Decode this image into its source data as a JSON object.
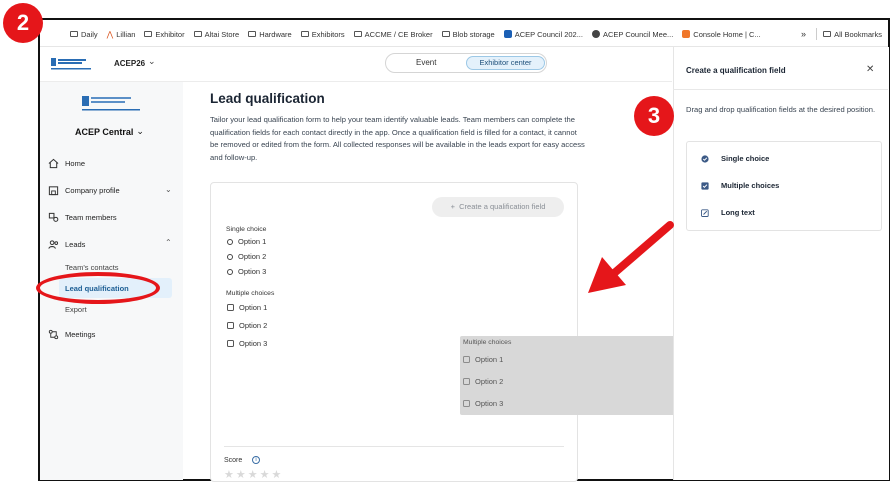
{
  "bookmarks": [
    {
      "label": "Daily",
      "icon": "folder-icon"
    },
    {
      "label": "Lillian",
      "icon": "bookmark-icon"
    },
    {
      "label": "Exhibitor",
      "icon": "folder-icon"
    },
    {
      "label": "Altai Store",
      "icon": "folder-icon"
    },
    {
      "label": "Hardware",
      "icon": "folder-icon"
    },
    {
      "label": "Exhibitors",
      "icon": "folder-icon"
    },
    {
      "label": "ACCME / CE Broker",
      "icon": "folder-icon"
    },
    {
      "label": "Blob storage",
      "icon": "folder-icon"
    },
    {
      "label": "ACEP Council 202...",
      "icon": "site-icon"
    },
    {
      "label": "ACEP Council Mee...",
      "icon": "site-icon"
    },
    {
      "label": "Console Home | C...",
      "icon": "site-icon"
    }
  ],
  "bookmarks_more": "»",
  "all_bookmarks": "All Bookmarks",
  "header": {
    "event_name": "ACEP26",
    "tabs": [
      "Event",
      "Exhibitor center"
    ]
  },
  "sidebar": {
    "org_name": "ACEP Central",
    "items": [
      {
        "label": "Home",
        "icon": "home-icon"
      },
      {
        "label": "Company profile",
        "icon": "building-icon"
      },
      {
        "label": "Team members",
        "icon": "team-icon"
      },
      {
        "label": "Leads",
        "icon": "leads-icon"
      },
      {
        "label": "Meetings",
        "icon": "meetings-icon"
      }
    ],
    "sub_items": [
      "Team's contacts",
      "Lead qualification",
      "Export"
    ]
  },
  "main": {
    "title": "Lead qualification",
    "description": "Tailor your lead qualification form to help your team identify valuable leads. Team members can complete the qualification fields for each contact directly in the app. Once a qualification field is filled for a contact, it cannot be removed or edited from the form. All collected responses will be available in the leads export for easy access and follow-up.",
    "create_button": "Create a qualification field",
    "single_choice": {
      "label": "Single choice",
      "options": [
        "Option 1",
        "Option 2",
        "Option 3"
      ]
    },
    "multiple_choices": {
      "label": "Multiple choices",
      "options": [
        "Option 1",
        "Option 2",
        "Option 3"
      ]
    },
    "score_label": "Score",
    "score_stars": "★★★★★"
  },
  "drag_ghost": {
    "label": "Multiple choices",
    "options": [
      "Option 1",
      "Option 2",
      "Option 3"
    ]
  },
  "drawer": {
    "title": "Create a qualification field",
    "description": "Drag and drop qualification fields at the desired position.",
    "fields": [
      {
        "label": "Single choice",
        "icon": "single-choice-icon"
      },
      {
        "label": "Multiple choices",
        "icon": "checkbox-icon"
      },
      {
        "label": "Long text",
        "icon": "edit-icon"
      }
    ]
  },
  "annotations": {
    "badge_2": "2",
    "badge_3": "3"
  },
  "colors": {
    "accent_red": "#e5161a",
    "active_blue": "#1d5f95",
    "active_bg": "#e3f0fb"
  }
}
